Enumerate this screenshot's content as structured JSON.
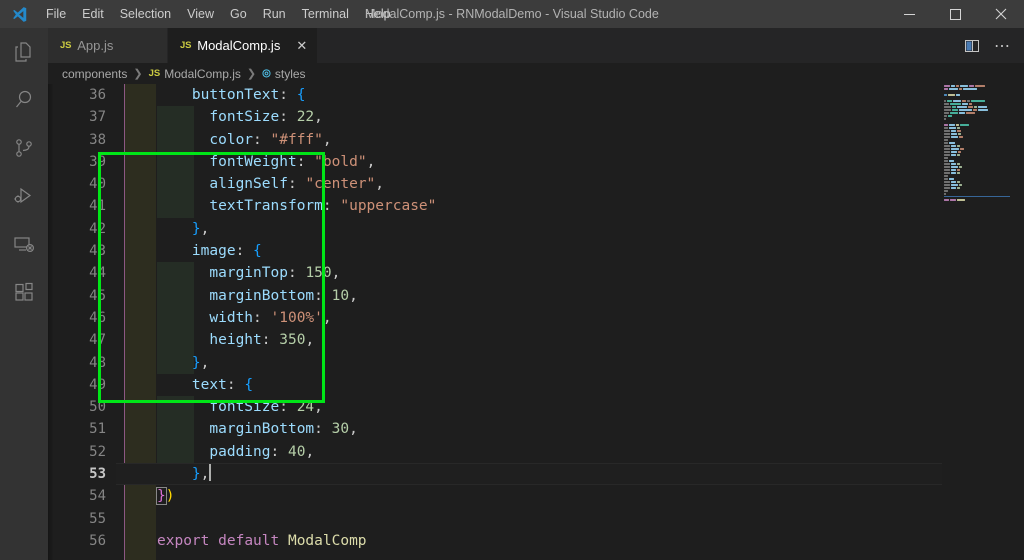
{
  "window": {
    "title": "ModalComp.js - RNModalDemo - Visual Studio Code",
    "minimize_label": "─",
    "maximize_label": "☐",
    "close_label": "✕"
  },
  "menubar": {
    "items": [
      {
        "label": "File"
      },
      {
        "label": "Edit"
      },
      {
        "label": "Selection"
      },
      {
        "label": "View"
      },
      {
        "label": "Go"
      },
      {
        "label": "Run"
      },
      {
        "label": "Terminal"
      },
      {
        "label": "Help"
      }
    ]
  },
  "activitybar": {
    "items": [
      {
        "name": "explorer",
        "title": "Explorer"
      },
      {
        "name": "search",
        "title": "Search"
      },
      {
        "name": "source-control",
        "title": "Source Control"
      },
      {
        "name": "run-debug",
        "title": "Run and Debug"
      },
      {
        "name": "remote-explorer",
        "title": "Remote Explorer"
      },
      {
        "name": "extensions",
        "title": "Extensions"
      }
    ]
  },
  "tabs": [
    {
      "label": "App.js",
      "badge": "JS",
      "active": false,
      "close": "✕"
    },
    {
      "label": "ModalComp.js",
      "badge": "JS",
      "active": true,
      "close": "✕"
    }
  ],
  "tabbar_actions": [
    {
      "name": "split-editor",
      "label": ""
    },
    {
      "name": "more-actions",
      "label": "⋯"
    }
  ],
  "breadcrumbs": [
    {
      "label": "components",
      "icon": ""
    },
    {
      "label": "ModalComp.js",
      "icon": "JS"
    },
    {
      "label": "styles",
      "icon": "◎"
    }
  ],
  "editor": {
    "active_line": 53,
    "first_line": 36,
    "cursor_after": "},",
    "annotation_color": "#00e617",
    "lines": [
      {
        "n": 36,
        "indent": 2,
        "tokens": [
          {
            "t": "buttonText",
            "c": "prop"
          },
          {
            "t": ": ",
            "c": "punc"
          },
          {
            "t": "{",
            "c": "brace3"
          }
        ]
      },
      {
        "n": 37,
        "indent": 3,
        "tokens": [
          {
            "t": "fontSize",
            "c": "prop"
          },
          {
            "t": ": ",
            "c": "punc"
          },
          {
            "t": "22",
            "c": "num"
          },
          {
            "t": ",",
            "c": "punc"
          }
        ]
      },
      {
        "n": 38,
        "indent": 3,
        "tokens": [
          {
            "t": "color",
            "c": "prop"
          },
          {
            "t": ": ",
            "c": "punc"
          },
          {
            "t": "\"#fff\"",
            "c": "str"
          },
          {
            "t": ",",
            "c": "punc"
          }
        ]
      },
      {
        "n": 39,
        "indent": 3,
        "tokens": [
          {
            "t": "fontWeight",
            "c": "prop"
          },
          {
            "t": ": ",
            "c": "punc"
          },
          {
            "t": "\"bold\"",
            "c": "str"
          },
          {
            "t": ",",
            "c": "punc"
          }
        ]
      },
      {
        "n": 40,
        "indent": 3,
        "tokens": [
          {
            "t": "alignSelf",
            "c": "prop"
          },
          {
            "t": ": ",
            "c": "punc"
          },
          {
            "t": "\"center\"",
            "c": "str"
          },
          {
            "t": ",",
            "c": "punc"
          }
        ]
      },
      {
        "n": 41,
        "indent": 3,
        "tokens": [
          {
            "t": "textTransform",
            "c": "prop"
          },
          {
            "t": ": ",
            "c": "punc"
          },
          {
            "t": "\"uppercase\"",
            "c": "str"
          }
        ]
      },
      {
        "n": 42,
        "indent": 2,
        "tokens": [
          {
            "t": "}",
            "c": "brace3"
          },
          {
            "t": ",",
            "c": "punc"
          }
        ]
      },
      {
        "n": 43,
        "indent": 2,
        "tokens": [
          {
            "t": "image",
            "c": "prop"
          },
          {
            "t": ": ",
            "c": "punc"
          },
          {
            "t": "{",
            "c": "brace3"
          }
        ]
      },
      {
        "n": 44,
        "indent": 3,
        "tokens": [
          {
            "t": "marginTop",
            "c": "prop"
          },
          {
            "t": ": ",
            "c": "punc"
          },
          {
            "t": "150",
            "c": "num"
          },
          {
            "t": ",",
            "c": "punc"
          }
        ]
      },
      {
        "n": 45,
        "indent": 3,
        "tokens": [
          {
            "t": "marginBottom",
            "c": "prop"
          },
          {
            "t": ": ",
            "c": "punc"
          },
          {
            "t": "10",
            "c": "num"
          },
          {
            "t": ",",
            "c": "punc"
          }
        ]
      },
      {
        "n": 46,
        "indent": 3,
        "tokens": [
          {
            "t": "width",
            "c": "prop"
          },
          {
            "t": ": ",
            "c": "punc"
          },
          {
            "t": "'100%'",
            "c": "str"
          },
          {
            "t": ",",
            "c": "punc"
          }
        ]
      },
      {
        "n": 47,
        "indent": 3,
        "tokens": [
          {
            "t": "height",
            "c": "prop"
          },
          {
            "t": ": ",
            "c": "punc"
          },
          {
            "t": "350",
            "c": "num"
          },
          {
            "t": ",",
            "c": "punc"
          }
        ]
      },
      {
        "n": 48,
        "indent": 2,
        "tokens": [
          {
            "t": "}",
            "c": "brace3"
          },
          {
            "t": ",",
            "c": "punc"
          }
        ]
      },
      {
        "n": 49,
        "indent": 2,
        "tokens": [
          {
            "t": "text",
            "c": "prop"
          },
          {
            "t": ": ",
            "c": "punc"
          },
          {
            "t": "{",
            "c": "brace3"
          }
        ]
      },
      {
        "n": 50,
        "indent": 3,
        "tokens": [
          {
            "t": "fontSize",
            "c": "prop"
          },
          {
            "t": ": ",
            "c": "punc"
          },
          {
            "t": "24",
            "c": "num"
          },
          {
            "t": ",",
            "c": "punc"
          }
        ]
      },
      {
        "n": 51,
        "indent": 3,
        "tokens": [
          {
            "t": "marginBottom",
            "c": "prop"
          },
          {
            "t": ": ",
            "c": "punc"
          },
          {
            "t": "30",
            "c": "num"
          },
          {
            "t": ",",
            "c": "punc"
          }
        ]
      },
      {
        "n": 52,
        "indent": 3,
        "tokens": [
          {
            "t": "padding",
            "c": "prop"
          },
          {
            "t": ": ",
            "c": "punc"
          },
          {
            "t": "40",
            "c": "num"
          },
          {
            "t": ",",
            "c": "punc"
          }
        ]
      },
      {
        "n": 53,
        "indent": 2,
        "tokens": [
          {
            "t": "}",
            "c": "brace3"
          },
          {
            "t": ",",
            "c": "punc"
          }
        ],
        "cursor": true
      },
      {
        "n": 54,
        "indent": 0,
        "tokens": [
          {
            "t": "}",
            "c": "brace2",
            "match": true
          },
          {
            "t": ")",
            "c": "brace"
          }
        ]
      },
      {
        "n": 55,
        "indent": 0,
        "tokens": []
      },
      {
        "n": 56,
        "indent": 0,
        "tokens": [
          {
            "t": "export",
            "c": "kw"
          },
          {
            "t": " ",
            "c": "punc"
          },
          {
            "t": "default",
            "c": "kw"
          },
          {
            "t": " ",
            "c": "punc"
          },
          {
            "t": "ModalComp",
            "c": "id"
          }
        ]
      }
    ]
  },
  "minimap": {
    "rows": [
      [
        {
          "w": 6,
          "c": "#c586c0"
        },
        {
          "w": 4,
          "c": "#9cdcfe"
        },
        {
          "w": 3,
          "c": "#ce9178"
        },
        {
          "w": 8,
          "c": "#9cdcfe"
        },
        {
          "w": 5,
          "c": "#c586c0"
        },
        {
          "w": 10,
          "c": "#ce9178"
        }
      ],
      [
        {
          "w": 4,
          "c": "#c586c0"
        },
        {
          "w": 9,
          "c": "#9cdcfe"
        },
        {
          "w": 3,
          "c": "#ce9178"
        },
        {
          "w": 14,
          "c": "#9cdcfe"
        }
      ],
      [],
      [
        {
          "w": 3,
          "c": "#569cd6"
        },
        {
          "w": 7,
          "c": "#dcdcaa"
        },
        {
          "w": 4,
          "c": "#9cdcfe"
        }
      ],
      [],
      [
        {
          "w": 2,
          "c": "#808080"
        },
        {
          "w": 5,
          "c": "#4ec9b0"
        },
        {
          "w": 8,
          "c": "#9cdcfe"
        },
        {
          "w": 4,
          "c": "#ce9178"
        },
        {
          "w": 3,
          "c": "#808080"
        },
        {
          "w": 14,
          "c": "#4ec9b0"
        }
      ],
      [
        {
          "w": 5,
          "c": "#808080"
        },
        {
          "w": 11,
          "c": "#4ec9b0"
        },
        {
          "w": 6,
          "c": "#9cdcfe"
        },
        {
          "w": 3,
          "c": "#ce9178"
        }
      ],
      [
        {
          "w": 7,
          "c": "#808080"
        },
        {
          "w": 4,
          "c": "#4ec9b0"
        },
        {
          "w": 10,
          "c": "#9cdcfe"
        },
        {
          "w": 5,
          "c": "#ce9178"
        },
        {
          "w": 3,
          "c": "#b5cea8"
        },
        {
          "w": 9,
          "c": "#9cdcfe"
        }
      ],
      [
        {
          "w": 7,
          "c": "#808080"
        },
        {
          "w": 6,
          "c": "#4ec9b0"
        },
        {
          "w": 13,
          "c": "#9cdcfe"
        },
        {
          "w": 4,
          "c": "#ce9178"
        },
        {
          "w": 10,
          "c": "#9cdcfe"
        }
      ],
      [
        {
          "w": 5,
          "c": "#808080"
        },
        {
          "w": 8,
          "c": "#4ec9b0"
        },
        {
          "w": 6,
          "c": "#9cdcfe"
        },
        {
          "w": 9,
          "c": "#ce9178"
        }
      ],
      [
        {
          "w": 3,
          "c": "#808080"
        },
        {
          "w": 4,
          "c": "#4ec9b0"
        }
      ],
      [
        {
          "w": 2,
          "c": "#808080"
        }
      ],
      [],
      [
        {
          "w": 4,
          "c": "#c586c0"
        },
        {
          "w": 6,
          "c": "#9cdcfe"
        },
        {
          "w": 3,
          "c": "#dcdcaa"
        },
        {
          "w": 9,
          "c": "#4ec9b0"
        }
      ],
      [
        {
          "w": 4,
          "c": "#808080"
        },
        {
          "w": 7,
          "c": "#9cdcfe"
        },
        {
          "w": 3,
          "c": "#b5cea8"
        }
      ],
      [
        {
          "w": 6,
          "c": "#808080"
        },
        {
          "w": 5,
          "c": "#9cdcfe"
        },
        {
          "w": 4,
          "c": "#ce9178"
        }
      ],
      [
        {
          "w": 6,
          "c": "#808080"
        },
        {
          "w": 6,
          "c": "#9cdcfe"
        },
        {
          "w": 3,
          "c": "#b5cea8"
        }
      ],
      [
        {
          "w": 6,
          "c": "#808080"
        },
        {
          "w": 7,
          "c": "#9cdcfe"
        },
        {
          "w": 4,
          "c": "#ce9178"
        }
      ],
      [
        {
          "w": 4,
          "c": "#808080"
        }
      ],
      [
        {
          "w": 4,
          "c": "#808080"
        },
        {
          "w": 6,
          "c": "#9cdcfe"
        }
      ],
      [
        {
          "w": 6,
          "c": "#808080"
        },
        {
          "w": 5,
          "c": "#9cdcfe"
        },
        {
          "w": 3,
          "c": "#b5cea8"
        }
      ],
      [
        {
          "w": 6,
          "c": "#808080"
        },
        {
          "w": 8,
          "c": "#9cdcfe"
        },
        {
          "w": 4,
          "c": "#ce9178"
        }
      ],
      [
        {
          "w": 6,
          "c": "#808080"
        },
        {
          "w": 6,
          "c": "#9cdcfe"
        },
        {
          "w": 3,
          "c": "#ce9178"
        }
      ],
      [
        {
          "w": 6,
          "c": "#808080"
        },
        {
          "w": 5,
          "c": "#9cdcfe"
        },
        {
          "w": 3,
          "c": "#b5cea8"
        }
      ],
      [
        {
          "w": 4,
          "c": "#808080"
        }
      ],
      [
        {
          "w": 4,
          "c": "#808080"
        },
        {
          "w": 5,
          "c": "#9cdcfe"
        }
      ],
      [
        {
          "w": 6,
          "c": "#808080"
        },
        {
          "w": 5,
          "c": "#9cdcfe"
        },
        {
          "w": 3,
          "c": "#b5cea8"
        }
      ],
      [
        {
          "w": 6,
          "c": "#808080"
        },
        {
          "w": 7,
          "c": "#9cdcfe"
        },
        {
          "w": 3,
          "c": "#b5cea8"
        }
      ],
      [
        {
          "w": 6,
          "c": "#808080"
        },
        {
          "w": 5,
          "c": "#9cdcfe"
        },
        {
          "w": 3,
          "c": "#ce9178"
        }
      ],
      [
        {
          "w": 6,
          "c": "#808080"
        },
        {
          "w": 5,
          "c": "#9cdcfe"
        },
        {
          "w": 3,
          "c": "#b5cea8"
        }
      ],
      [
        {
          "w": 4,
          "c": "#808080"
        }
      ],
      [
        {
          "w": 4,
          "c": "#808080"
        },
        {
          "w": 5,
          "c": "#9cdcfe"
        }
      ],
      [
        {
          "w": 6,
          "c": "#808080"
        },
        {
          "w": 5,
          "c": "#9cdcfe"
        },
        {
          "w": 3,
          "c": "#b5cea8"
        }
      ],
      [
        {
          "w": 6,
          "c": "#808080"
        },
        {
          "w": 7,
          "c": "#9cdcfe"
        },
        {
          "w": 3,
          "c": "#b5cea8"
        }
      ],
      [
        {
          "w": 6,
          "c": "#808080"
        },
        {
          "w": 5,
          "c": "#9cdcfe"
        },
        {
          "w": 3,
          "c": "#b5cea8"
        }
      ],
      [
        {
          "w": 4,
          "c": "#808080"
        }
      ],
      [
        {
          "w": 2,
          "c": "#808080"
        }
      ],
      [],
      [
        {
          "w": 5,
          "c": "#c586c0"
        },
        {
          "w": 6,
          "c": "#c586c0"
        },
        {
          "w": 8,
          "c": "#dcdcaa"
        }
      ]
    ]
  }
}
